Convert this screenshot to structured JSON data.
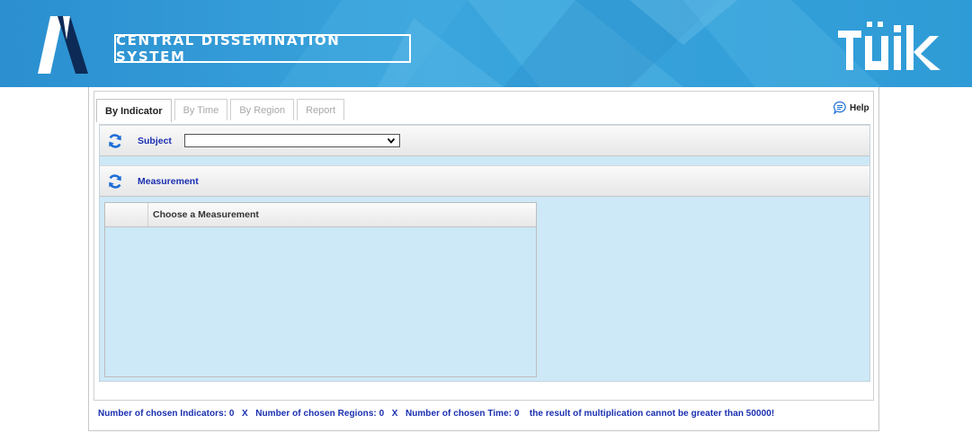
{
  "header": {
    "title": "CENTRAL DISSEMINATION SYSTEM",
    "left_logo_icon": "stylized-m-logo-icon",
    "right_logo_text": "TÜIK",
    "colors": {
      "banner": "#2b8fd0",
      "banner_light": "#4fb3e3"
    }
  },
  "tabs": [
    {
      "label": "By Indicator",
      "active": true
    },
    {
      "label": "By Time",
      "active": false
    },
    {
      "label": "By Region",
      "active": false
    },
    {
      "label": "Report",
      "active": false
    }
  ],
  "help": {
    "label": "Help",
    "icon": "help-speech-bubble-icon"
  },
  "subject": {
    "label": "Subject",
    "selected_value": "",
    "icon": "refresh-icon"
  },
  "measurement": {
    "label": "Measurement",
    "icon": "refresh-icon",
    "grid_header": "Choose a Measurement",
    "rows": []
  },
  "footer": {
    "text": "Number of chosen Indicators: 0   X   Number of chosen Regions: 0   X   Number of chosen Time: 0    the result of multiplication cannot be greater than 50000!"
  },
  "colors": {
    "label_blue": "#1a2fb0",
    "panel_bg": "#cde8f6",
    "refresh_icon": "#1f6fd6"
  }
}
